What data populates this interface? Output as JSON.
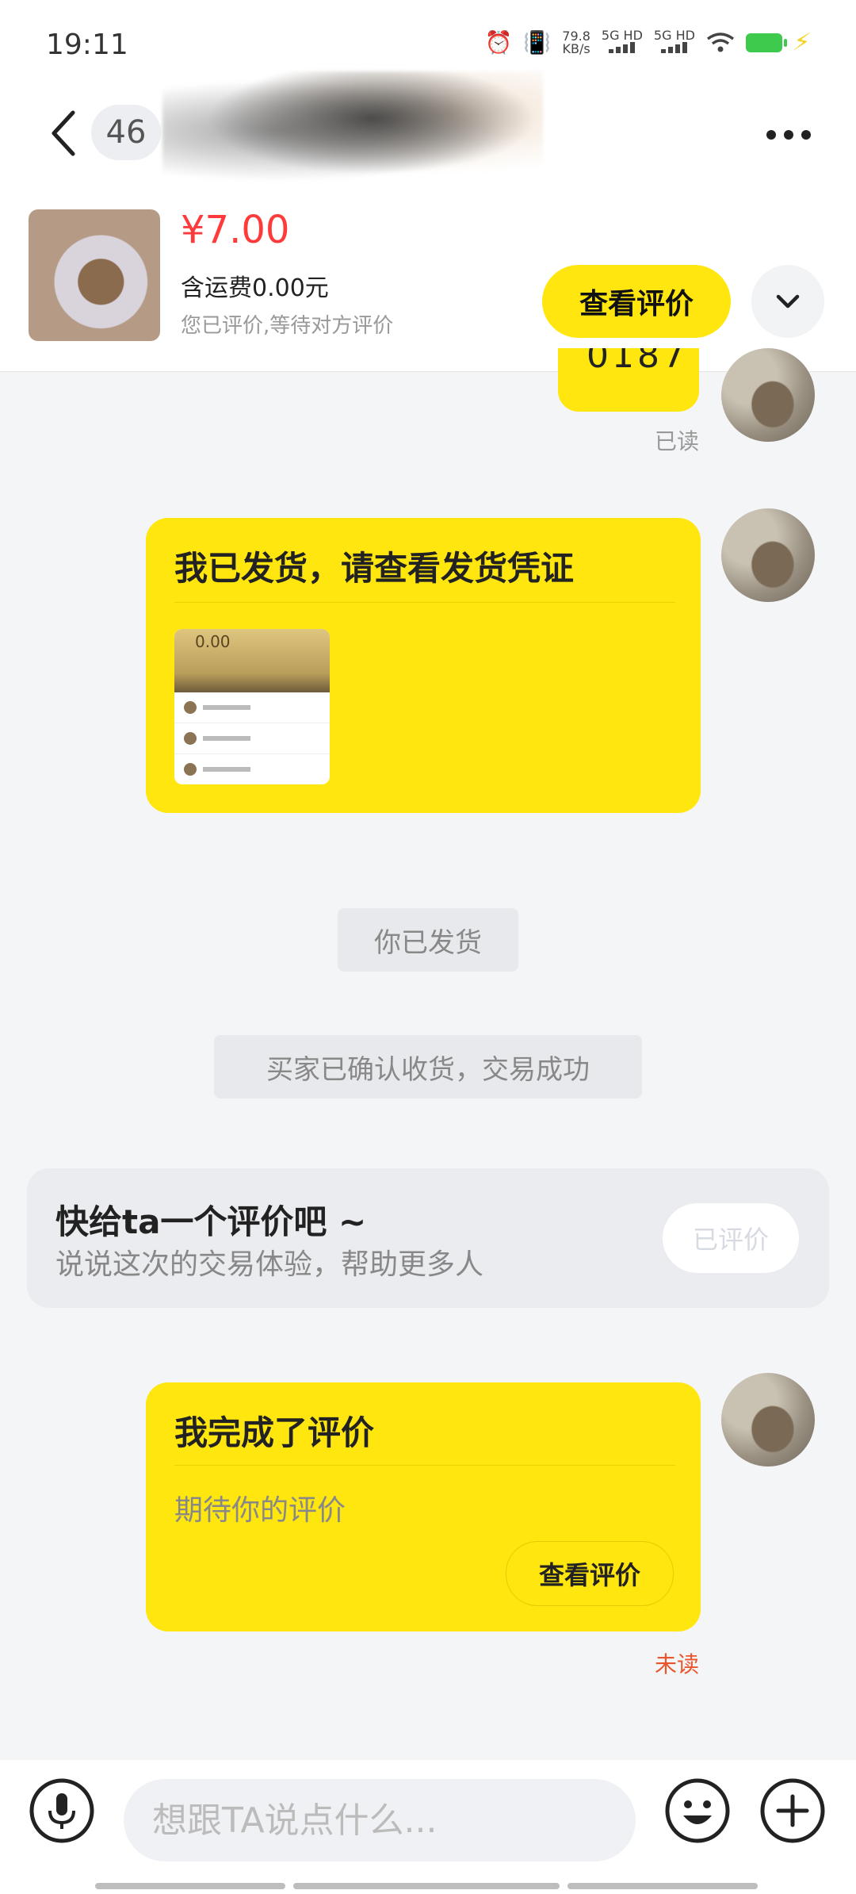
{
  "status_bar": {
    "time": "19:11",
    "net_speed_value": "79.8",
    "net_speed_unit": "KB/s",
    "sim1": "5G HD",
    "sim2": "5G HD",
    "battery_color": "#3ecb4d"
  },
  "header": {
    "unread_count": "46",
    "back_icon": "chevron-left-icon",
    "more_icon": "more-dots-icon"
  },
  "product": {
    "price": "¥7.00",
    "shipping": "含运费0.00元",
    "rate_status": "您已评价,等待对方评价",
    "view_review_label": "查看评价",
    "collapse_icon": "chevron-down-icon"
  },
  "chat": {
    "partial_message": "0187",
    "read_label": "已读",
    "shipping_card": {
      "title": "我已发货，请查看发货凭证",
      "proof_amount": "0.00"
    },
    "system_shipped": "你已发货",
    "system_confirmed": "买家已确认收货，交易成功",
    "review_prompt": {
      "title": "快给ta一个评价吧 ~",
      "subtitle": "说说这次的交易体验，帮助更多人",
      "button_label": "已评价"
    },
    "review_done_card": {
      "title": "我完成了评价",
      "subtitle": "期待你的评价",
      "button_label": "查看评价"
    },
    "unread_label": "未读"
  },
  "input_bar": {
    "placeholder": "想跟TA说点什么...",
    "mic_icon": "microphone-icon",
    "emoji_icon": "emoji-icon",
    "plus_icon": "plus-icon"
  },
  "colors": {
    "accent_yellow": "#ffe60f",
    "price_red": "#ff3a3a",
    "unread_orange": "#e9552c"
  }
}
